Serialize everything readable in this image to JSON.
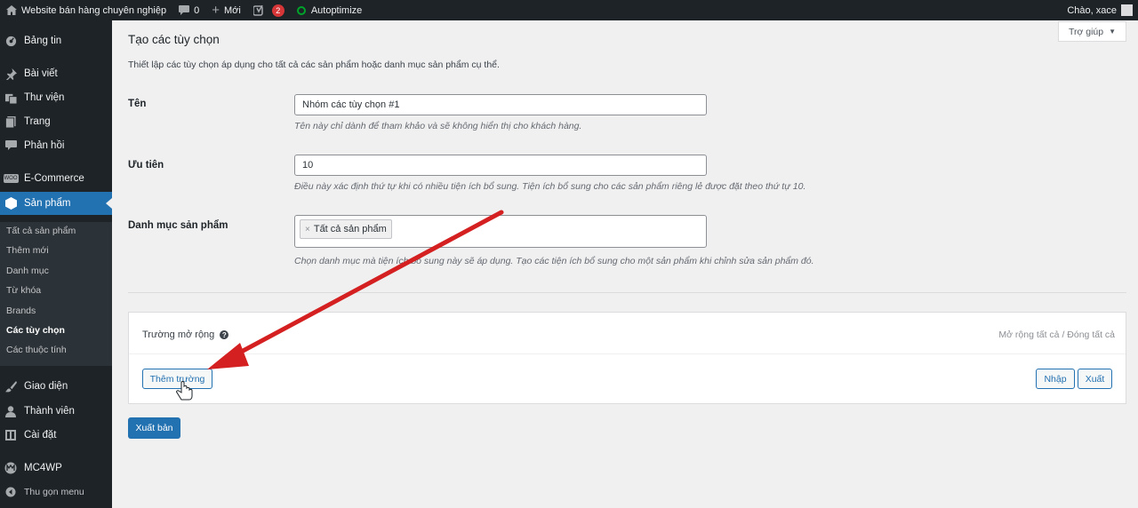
{
  "adminbar": {
    "site_name": "Website bán hàng chuyên nghiệp",
    "comments_count": "0",
    "new_label": "Mới",
    "yoast_count": "2",
    "autoptimize_label": "Autoptimize",
    "greeting": "Chào, xace"
  },
  "menu": {
    "items": [
      {
        "label": "Bảng tin",
        "icon": "dashboard-icon"
      },
      {
        "label": "Bài viết",
        "icon": "pin-icon"
      },
      {
        "label": "Thư viện",
        "icon": "media-icon"
      },
      {
        "label": "Trang",
        "icon": "page-icon"
      },
      {
        "label": "Phản hồi",
        "icon": "comment-icon"
      },
      {
        "label": "E-Commerce",
        "icon": "woo-icon"
      },
      {
        "label": "Sản phẩm",
        "icon": "product-box-icon"
      },
      {
        "label": "Giao diện",
        "icon": "brush-icon"
      },
      {
        "label": "Thành viên",
        "icon": "user-icon"
      },
      {
        "label": "Cài đặt",
        "icon": "settings-icon"
      },
      {
        "label": "MC4WP",
        "icon": "mc4wp-icon"
      },
      {
        "label": "Thu gọn menu",
        "icon": "collapse-icon"
      }
    ],
    "submenu": [
      "Tất cả sản phẩm",
      "Thêm mới",
      "Danh mục",
      "Từ khóa",
      "Brands",
      "Các tùy chọn",
      "Các thuộc tính"
    ]
  },
  "help_label": "Trợ giúp",
  "page": {
    "title": "Tạo các tùy chọn",
    "description": "Thiết lập các tùy chọn áp dụng cho tất cả các sản phẩm hoặc danh mục sản phẩm cụ thể."
  },
  "form": {
    "name_label": "Tên",
    "name_value": "Nhóm các tùy chọn #1",
    "name_hint": "Tên này chỉ dành để tham khảo và sẽ không hiển thị cho khách hàng.",
    "priority_label": "Ưu tiên",
    "priority_value": "10",
    "priority_hint": "Điều này xác định thứ tự khi có nhiều tiện ích bổ sung. Tiện ích bổ sung cho các sản phẩm riêng lẻ được đặt theo thứ tự 10.",
    "category_label": "Danh mục sản phẩm",
    "category_token": "Tất cả sản phẩm",
    "category_token_remove": "×",
    "category_hint": "Chọn danh mục mà tiện ích bổ sung này sẽ áp dụng. Tạo các tiện ích bổ sung cho một sản phẩm khi chỉnh sửa sản phẩm đó."
  },
  "fields_panel": {
    "title": "Trường mở rộng",
    "expand_all": "Mở rộng tất cả",
    "separator": "/",
    "collapse_all": "Đóng tất cả",
    "add_field": "Thêm trường",
    "import": "Nhập",
    "export": "Xuất"
  },
  "publish_label": "Xuất bản",
  "annotation_arrow_color": "#d42020"
}
